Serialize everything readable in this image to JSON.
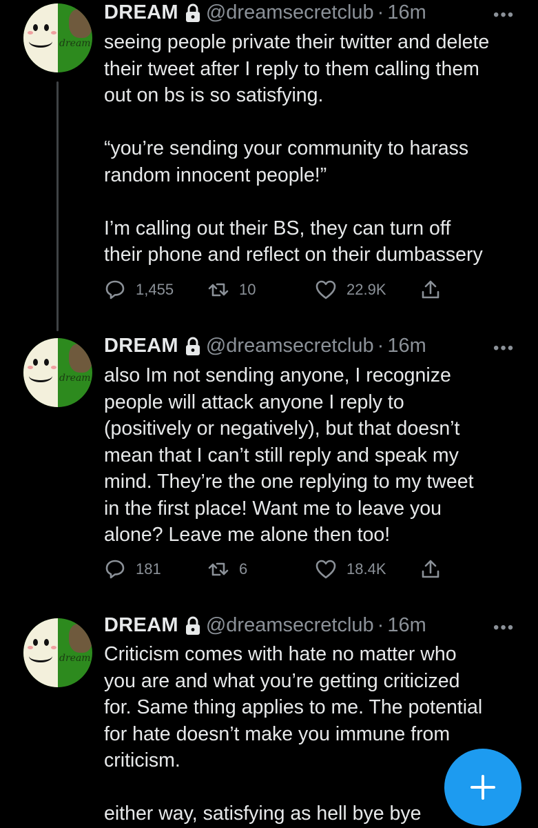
{
  "tweets": [
    {
      "name": "DREAM",
      "handle": "@dreamsecretclub",
      "separator": "·",
      "time": "16m",
      "more": "•••",
      "avatar_label": "dream",
      "lines": [
        "seeing people private their twitter and delete",
        "their tweet after I reply to them calling them",
        "out on bs is so satisfying.",
        "",
        "“you’re sending your community to harass",
        "random innocent people!”",
        "",
        "I’m calling out their BS, they can turn off",
        "their phone and reflect on their dumbassery"
      ],
      "replies": "1,455",
      "retweets": "10",
      "likes": "22.9K"
    },
    {
      "name": "DREAM",
      "handle": "@dreamsecretclub",
      "separator": "·",
      "time": "16m",
      "more": "•••",
      "avatar_label": "dream",
      "lines": [
        "also Im not sending anyone, I recognize",
        "people will attack anyone I reply to",
        "(positively or negatively), but that doesn’t",
        "mean that I can’t still reply and speak my",
        "mind. They’re the one replying to my tweet",
        "in the first place! Want me to leave you",
        "alone? Leave me alone then too!"
      ],
      "replies": "181",
      "retweets": "6",
      "likes": "18.4K"
    },
    {
      "name": "DREAM",
      "handle": "@dreamsecretclub",
      "separator": "·",
      "time": "16m",
      "more": "•••",
      "avatar_label": "dream",
      "lines": [
        "Criticism comes with hate no matter who",
        "you are and what you’re getting criticized",
        "for. Same thing applies to me. The potential",
        "for hate doesn’t make you immune from",
        "criticism.",
        "",
        "either way, satisfying as hell bye bye"
      ]
    }
  ],
  "icons": {
    "lock": "lock-icon",
    "reply": "reply-icon",
    "retweet": "retweet-icon",
    "like": "heart-icon",
    "share": "share-icon",
    "compose": "plus-icon"
  },
  "colors": {
    "background": "#000000",
    "text": "#e7e9ea",
    "muted": "#8b9198",
    "accent": "#1d9bf0",
    "thread_line": "#3f4245"
  }
}
